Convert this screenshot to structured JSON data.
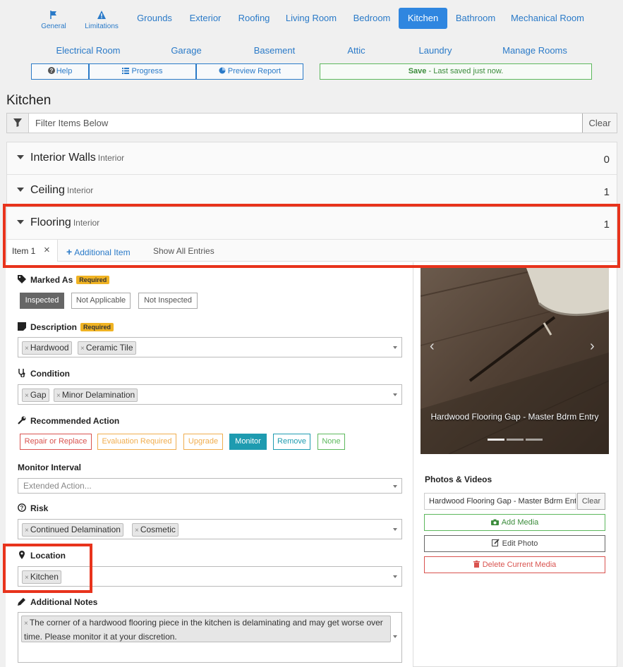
{
  "nav": {
    "general": "General",
    "limitations": "Limitations",
    "row1": [
      "Grounds",
      "Exterior",
      "Roofing",
      "Living Room",
      "Bedroom",
      "Kitchen",
      "Bathroom",
      "Mechanical Room"
    ],
    "row2": [
      "Electrical Room",
      "Garage",
      "Basement",
      "Attic",
      "Laundry",
      "Manage Rooms"
    ],
    "active": "Kitchen"
  },
  "toolbar": {
    "help": "Help",
    "progress": "Progress",
    "preview": "Preview Report",
    "save_bold": "Save",
    "save_rest": " - Last saved just now."
  },
  "page_title": "Kitchen",
  "filter": {
    "placeholder": "Filter Items Below",
    "clear": "Clear"
  },
  "sections": [
    {
      "title": "Interior Walls",
      "sub": "Interior",
      "count": "0"
    },
    {
      "title": "Ceiling",
      "sub": "Interior",
      "count": "1"
    },
    {
      "title": "Flooring",
      "sub": "Interior",
      "count": "1"
    }
  ],
  "item_tabs": {
    "item1": "Item 1",
    "close": "×",
    "additional": "Additional Item",
    "show_all": "Show All Entries"
  },
  "form": {
    "marked_as": {
      "label": "Marked As",
      "required": "Required",
      "options": [
        "Inspected",
        "Not Applicable",
        "Not Inspected"
      ],
      "selected": "Inspected"
    },
    "description": {
      "label": "Description",
      "required": "Required",
      "chips": [
        "Hardwood",
        "Ceramic Tile"
      ]
    },
    "condition": {
      "label": "Condition",
      "chips": [
        "Gap",
        "Minor Delamination"
      ]
    },
    "recommended_action": {
      "label": "Recommended Action",
      "options": [
        "Repair or Replace",
        "Evaluation Required",
        "Upgrade",
        "Monitor",
        "Remove",
        "None"
      ],
      "selected": "Monitor"
    },
    "monitor_interval": {
      "label": "Monitor Interval",
      "placeholder": "Extended Action..."
    },
    "risk": {
      "label": "Risk",
      "chips": [
        "Continued Delamination",
        "Cosmetic"
      ]
    },
    "location": {
      "label": "Location",
      "chips": [
        "Kitchen"
      ]
    },
    "notes": {
      "label": "Additional Notes",
      "text": "The corner of a hardwood flooring piece in the kitchen is delaminating and may get worse over time. Please monitor it at your discretion."
    }
  },
  "media": {
    "caption": "Hardwood Flooring Gap - Master Bdrm Entry",
    "section_label": "Photos & Videos",
    "input_value": "Hardwood Flooring Gap - Master Bdrm Entry",
    "clear": "Clear",
    "add": "Add Media",
    "edit": "Edit Photo",
    "delete": "Delete Current Media"
  },
  "colors": {
    "accent": "#2f86e0",
    "success": "#5cb85c",
    "danger": "#d9534f",
    "warning": "#f0ad4e",
    "info": "#1e9bb0",
    "highlight": "#e8331c"
  }
}
